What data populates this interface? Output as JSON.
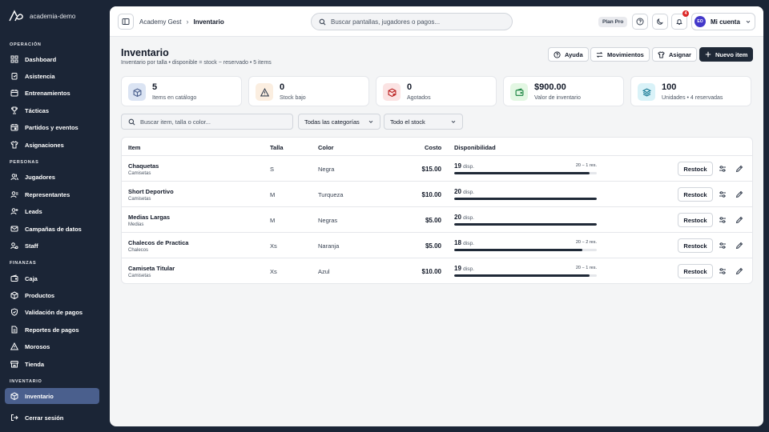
{
  "app": {
    "name": "academia-demo"
  },
  "sidebar": {
    "sections": [
      {
        "title": "OPERACIÓN",
        "items": [
          {
            "label": "Dashboard",
            "icon": "dashboard-icon"
          },
          {
            "label": "Asistencia",
            "icon": "clipboard-icon"
          },
          {
            "label": "Entrenamientos",
            "icon": "calendar-icon"
          },
          {
            "label": "Tácticas",
            "icon": "trophy-icon"
          },
          {
            "label": "Partidos y eventos",
            "icon": "calendar-event-icon"
          },
          {
            "label": "Asignaciones",
            "icon": "shirt-icon"
          }
        ]
      },
      {
        "title": "PERSONAS",
        "items": [
          {
            "label": "Jugadores",
            "icon": "users-icon"
          },
          {
            "label": "Representantes",
            "icon": "contact-icon"
          },
          {
            "label": "Leads",
            "icon": "user-plus-icon"
          },
          {
            "label": "Campañas de datos",
            "icon": "mail-icon"
          },
          {
            "label": "Staff",
            "icon": "staff-icon"
          }
        ]
      },
      {
        "title": "FINANZAS",
        "items": [
          {
            "label": "Caja",
            "icon": "wallet-icon"
          },
          {
            "label": "Productos",
            "icon": "package-icon"
          },
          {
            "label": "Validación de pagos",
            "icon": "shield-check-icon"
          },
          {
            "label": "Reportes de pagos",
            "icon": "file-icon"
          },
          {
            "label": "Morosos",
            "icon": "alert-icon"
          },
          {
            "label": "Tienda",
            "icon": "store-icon"
          }
        ]
      },
      {
        "title": "INVENTARIO",
        "items": [
          {
            "label": "Inventario",
            "icon": "box-icon",
            "active": true
          }
        ]
      }
    ],
    "logout": "Cerrar sesión"
  },
  "topbar": {
    "breadcrumb": [
      "Academy Gest",
      "Inventario"
    ],
    "search_placeholder": "Buscar pantallas, jugadores o pagos...",
    "plan": "Plan Pro",
    "notifications": "4",
    "avatar_initials": "EO",
    "account": "Mi cuenta"
  },
  "page": {
    "title": "Inventario",
    "subtitle": "Inventario por talla • disponible = stock − reservado • 5 items",
    "actions": {
      "help": "Ayuda",
      "movements": "Movimientos",
      "assign": "Asignar",
      "new": "Nuevo item"
    }
  },
  "stats": [
    {
      "value": "5",
      "label": "Items en catálogo",
      "icon": "cube-icon",
      "bg": "#dbe4f3",
      "fg": "#4a5f8d"
    },
    {
      "value": "0",
      "label": "Stock bajo",
      "icon": "warning-icon",
      "bg": "#fbeee0",
      "fg": "#374151"
    },
    {
      "value": "0",
      "label": "Agotados",
      "icon": "box-x-icon",
      "bg": "#fbe3e3",
      "fg": "#b91c1c"
    },
    {
      "value": "$900.00",
      "label": "Valor de inventario",
      "icon": "wallet-icon",
      "bg": "#e3f7e3",
      "fg": "#15803d"
    },
    {
      "value": "100",
      "label": "Unidades • 4 reservadas",
      "icon": "layers-icon",
      "bg": "#d9f2f8",
      "fg": "#0e7490"
    }
  ],
  "filters": {
    "search_placeholder": "Buscar item, talla o color...",
    "category": "Todas las categorías",
    "stock": "Todo el stock"
  },
  "table": {
    "columns": {
      "item": "Item",
      "size": "Talla",
      "color": "Color",
      "cost": "Costo",
      "availability": "Disponibilidad"
    },
    "disp_suffix": "disp.",
    "restock_label": "Restock",
    "rows": [
      {
        "name": "Chaquetas",
        "category": "Camisetas",
        "size": "S",
        "color": "Negra",
        "cost": "$15.00",
        "available": "19",
        "reserved_note": "20 − 1 res.",
        "fill": 0.95
      },
      {
        "name": "Short Deportivo",
        "category": "Camisetas",
        "size": "M",
        "color": "Turqueza",
        "cost": "$10.00",
        "available": "20",
        "reserved_note": "",
        "fill": 1.0
      },
      {
        "name": "Medias Largas",
        "category": "Medias",
        "size": "M",
        "color": "Negras",
        "cost": "$5.00",
        "available": "20",
        "reserved_note": "",
        "fill": 1.0
      },
      {
        "name": "Chalecos de Practica",
        "category": "Chalecos",
        "size": "Xs",
        "color": "Naranja",
        "cost": "$5.00",
        "available": "18",
        "reserved_note": "20 − 2 res.",
        "fill": 0.9
      },
      {
        "name": "Camiseta Titular",
        "category": "Camisetas",
        "size": "Xs",
        "color": "Azul",
        "cost": "$10.00",
        "available": "19",
        "reserved_note": "20 − 1 res.",
        "fill": 0.95
      }
    ]
  }
}
